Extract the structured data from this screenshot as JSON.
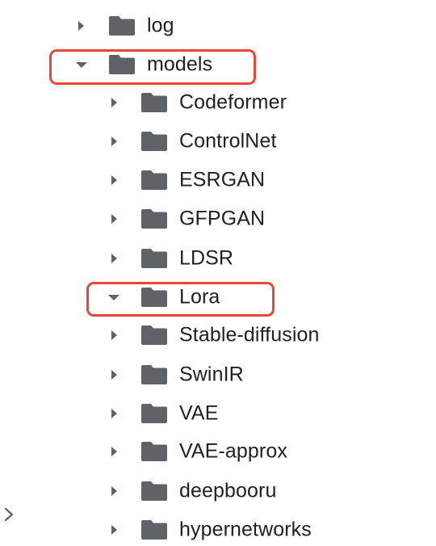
{
  "items": [
    {
      "label": "log",
      "state": "collapsed"
    },
    {
      "label": "models",
      "state": "expanded"
    },
    {
      "label": "Codeformer",
      "state": "collapsed"
    },
    {
      "label": "ControlNet",
      "state": "collapsed"
    },
    {
      "label": "ESRGAN",
      "state": "collapsed"
    },
    {
      "label": "GFPGAN",
      "state": "collapsed"
    },
    {
      "label": "LDSR",
      "state": "collapsed"
    },
    {
      "label": "Lora",
      "state": "expanded"
    },
    {
      "label": "Stable-diffusion",
      "state": "collapsed"
    },
    {
      "label": "SwinIR",
      "state": "collapsed"
    },
    {
      "label": "VAE",
      "state": "collapsed"
    },
    {
      "label": "VAE-approx",
      "state": "collapsed"
    },
    {
      "label": "deepbooru",
      "state": "collapsed"
    },
    {
      "label": "hypernetworks",
      "state": "collapsed"
    }
  ],
  "colors": {
    "icon": "#5f6368",
    "text": "#202124",
    "highlight": "#e8473a"
  },
  "icons": {
    "folder": "folder-icon",
    "collapsed": "chevron-right-icon",
    "expanded": "chevron-down-icon",
    "side": "chevron-right-icon"
  }
}
